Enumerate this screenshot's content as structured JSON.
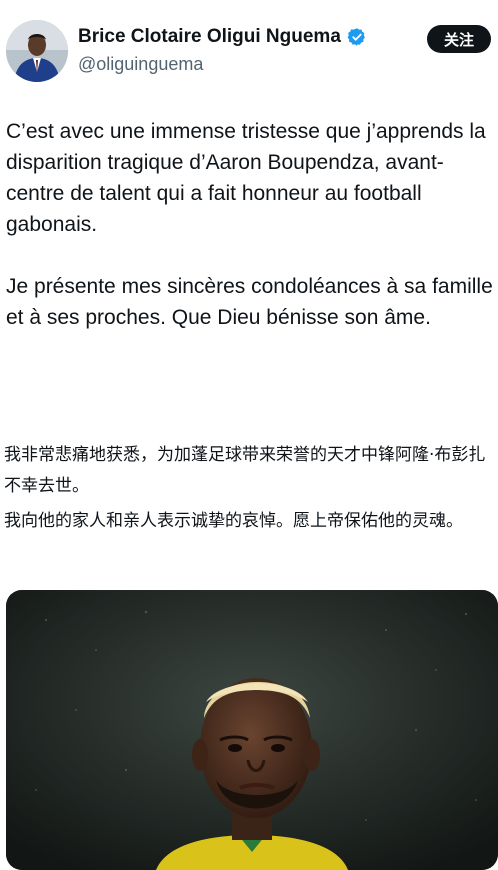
{
  "author": {
    "name": "Brice Clotaire Oligui Nguema",
    "handle": "@oliguinguema",
    "verified_icon": "verified-badge-icon",
    "avatar_icon": "avatar"
  },
  "follow_button": {
    "label": "关注"
  },
  "tweet": {
    "paragraphs_fr": [
      "C’est avec une immense tristesse que j’apprends la disparition tragique d’Aaron Boupendza, avant-centre de talent qui a fait honneur au football gabonais.",
      "Je présente mes sincères condoléances à sa famille et à ses proches. Que Dieu bénisse son âme."
    ],
    "paragraphs_zh": [
      "我非常悲痛地获悉，为加蓬足球带来荣誉的天才中锋阿隆·布彭扎不幸去世。",
      "我向他的家人和亲人表示诚挚的哀悼。愿上帝保佑他的灵魂。"
    ]
  },
  "colors": {
    "text": "#0f1419",
    "secondary_text": "#536471",
    "verified_blue": "#1d9bf0",
    "follow_bg": "#0f1419"
  }
}
